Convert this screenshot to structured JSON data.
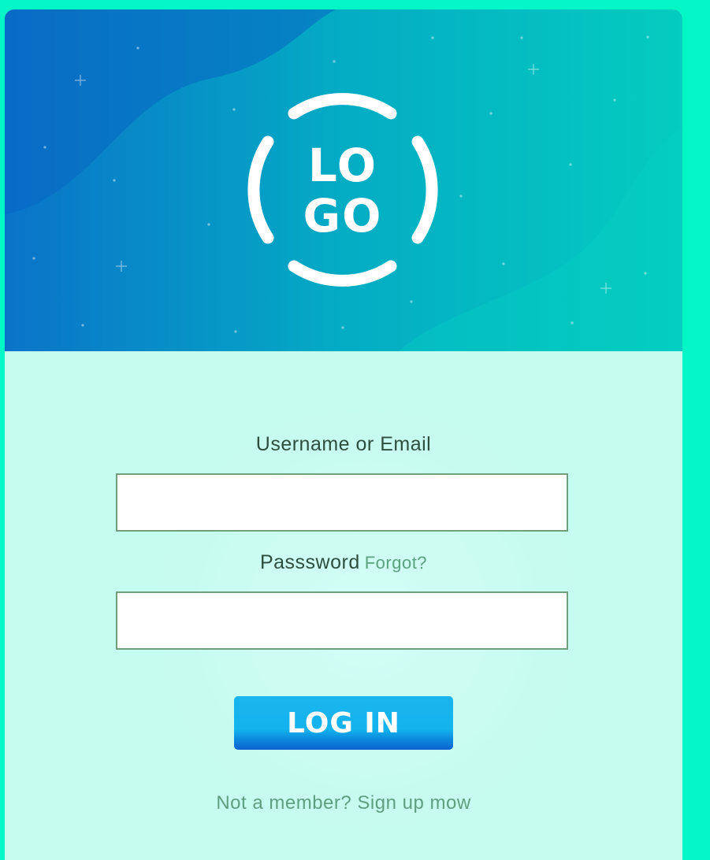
{
  "logo": {
    "line1": "LO",
    "line2": "GO"
  },
  "form": {
    "username_label": "Username or Email",
    "username_value": "",
    "password_label": "Passsword",
    "forgot_link": "Forgot?",
    "password_value": "",
    "login_button": "LOG IN",
    "signup_text": "Not a member? Sign up mow"
  },
  "colors": {
    "page_background": "#03f7c6",
    "hero_gradient_start": "#0a73c9",
    "hero_gradient_end": "#04ccc0",
    "form_background": "#c6fbef",
    "button": "#14b3ee",
    "label_text": "#2c4e3d",
    "link_text": "#5aa27e"
  }
}
